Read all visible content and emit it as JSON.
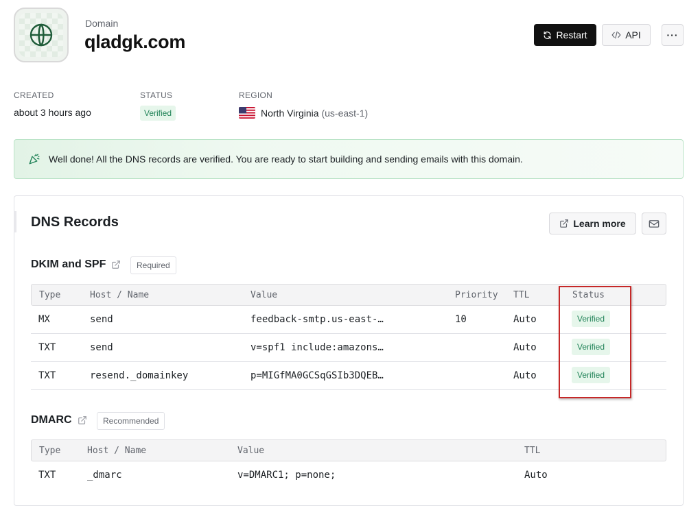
{
  "header": {
    "eyebrow": "Domain",
    "domain": "qladgk.com",
    "restart_label": "Restart",
    "api_label": "API",
    "more_label": "···"
  },
  "meta": {
    "created_label": "CREATED",
    "created_value": "about 3 hours ago",
    "status_label": "STATUS",
    "status_value": "Verified",
    "region_label": "REGION",
    "region_name": "North Virginia",
    "region_code": "(us-east-1)"
  },
  "banner": {
    "text": "Well done! All the DNS records are verified. You are ready to start building and sending emails with this domain."
  },
  "dns": {
    "title": "DNS Records",
    "learn_more_label": "Learn more",
    "dkim": {
      "title": "DKIM and SPF",
      "pill": "Required",
      "headers": {
        "type": "Type",
        "host": "Host / Name",
        "value": "Value",
        "priority": "Priority",
        "ttl": "TTL",
        "status": "Status"
      },
      "rows": [
        {
          "type": "MX",
          "host": "send",
          "value": "feedback-smtp.us-east-…",
          "priority": "10",
          "ttl": "Auto",
          "status": "Verified"
        },
        {
          "type": "TXT",
          "host": "send",
          "value": "v=spf1 include:amazons…",
          "priority": "",
          "ttl": "Auto",
          "status": "Verified"
        },
        {
          "type": "TXT",
          "host": "resend._domainkey",
          "value": "p=MIGfMA0GCSqGSIb3DQEB…",
          "priority": "",
          "ttl": "Auto",
          "status": "Verified"
        }
      ]
    },
    "dmarc": {
      "title": "DMARC",
      "pill": "Recommended",
      "headers": {
        "type": "Type",
        "host": "Host / Name",
        "value": "Value",
        "ttl": "TTL"
      },
      "rows": [
        {
          "type": "TXT",
          "host": "_dmarc",
          "value": "v=DMARC1; p=none;",
          "ttl": "Auto"
        }
      ]
    }
  },
  "icons": {
    "logo": "globe-icon",
    "restart": "refresh-icon",
    "api": "code-icon",
    "banner": "party-popper-icon",
    "external": "external-link-icon",
    "mail": "mail-icon",
    "flag": "us-flag-icon"
  },
  "colors": {
    "accent_dark": "#111111",
    "success_text": "#218358",
    "success_bg": "#e6f6eb",
    "highlight": "#c62828"
  }
}
